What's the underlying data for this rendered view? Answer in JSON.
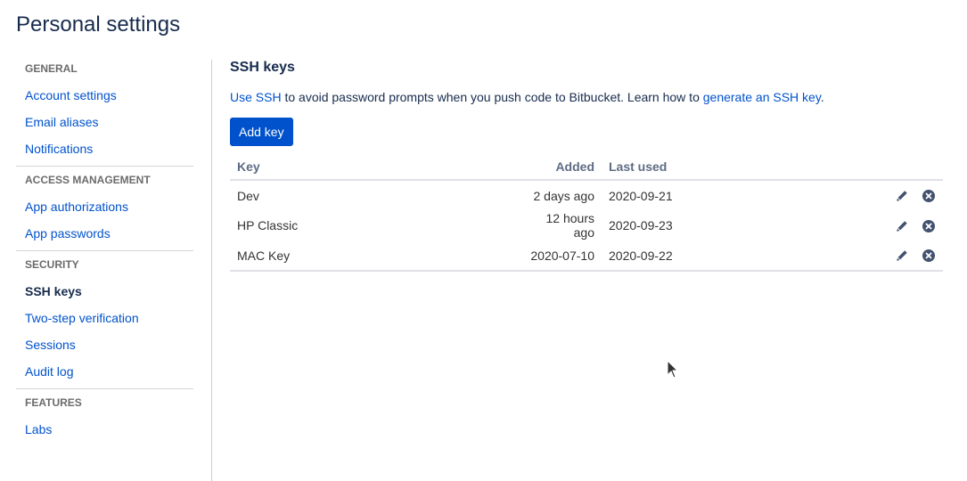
{
  "page": {
    "title": "Personal settings"
  },
  "sidebar": {
    "groups": [
      {
        "heading": "GENERAL",
        "items": [
          {
            "label": "Account settings"
          },
          {
            "label": "Email aliases"
          },
          {
            "label": "Notifications"
          }
        ]
      },
      {
        "heading": "ACCESS MANAGEMENT",
        "items": [
          {
            "label": "App authorizations"
          },
          {
            "label": "App passwords"
          }
        ]
      },
      {
        "heading": "SECURITY",
        "items": [
          {
            "label": "SSH keys",
            "active": true
          },
          {
            "label": "Two-step verification"
          },
          {
            "label": "Sessions"
          },
          {
            "label": "Audit log"
          }
        ]
      },
      {
        "heading": "FEATURES",
        "items": [
          {
            "label": "Labs"
          }
        ]
      }
    ]
  },
  "main": {
    "title": "SSH keys",
    "description": {
      "link1": "Use SSH",
      "text1": " to avoid password prompts when you push code to Bitbucket. Learn how to ",
      "link2": "generate an SSH key",
      "text2": "."
    },
    "add_button": "Add key",
    "table": {
      "headers": {
        "key": "Key",
        "added": "Added",
        "last_used": "Last used"
      },
      "rows": [
        {
          "key": "Dev",
          "added": "2 days ago",
          "last_used": "2020-09-21"
        },
        {
          "key": "HP Classic",
          "added": "12 hours ago",
          "last_used": "2020-09-23"
        },
        {
          "key": "MAC Key",
          "added": "2020-07-10",
          "last_used": "2020-09-22"
        }
      ],
      "row_actions": [
        "edit-icon",
        "delete-icon"
      ]
    }
  },
  "colors": {
    "link": "#0052cc",
    "primary_button": "#0052cc",
    "text": "#172b4d",
    "icon": "#42526e"
  }
}
